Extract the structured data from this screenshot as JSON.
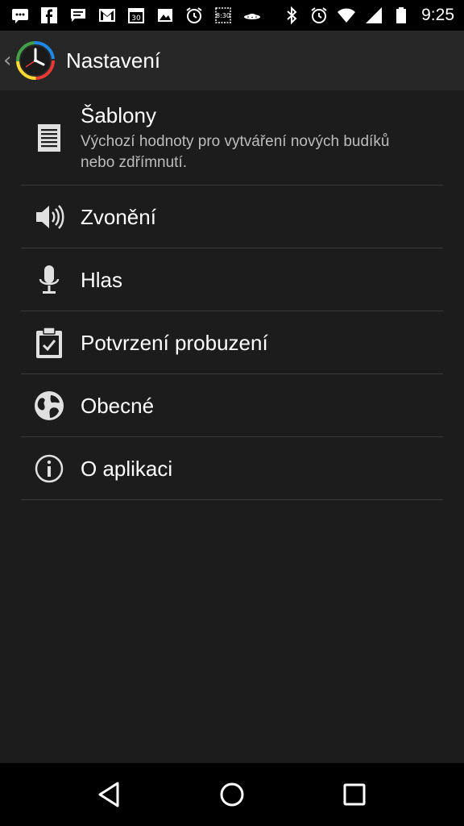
{
  "status_bar": {
    "time": "9:25",
    "left_icons": [
      "messages-icon",
      "facebook-icon",
      "chat-icon",
      "gmail-icon",
      "calendar-icon",
      "gallery-icon",
      "alarm-icon",
      "clock-icon",
      "ufo-icon"
    ],
    "right_icons": [
      "bluetooth-icon",
      "alarm-icon",
      "wifi-icon",
      "signal-icon",
      "battery-icon"
    ]
  },
  "app_bar": {
    "title": "Nastavení"
  },
  "settings": [
    {
      "name": "templates",
      "title": "Šablony",
      "summary": "Výchozí hodnoty pro vytváření nových budíků nebo zdřímnutí.",
      "icon": "document-icon"
    },
    {
      "name": "ringing",
      "title": "Zvonění",
      "summary": "",
      "icon": "speaker-icon"
    },
    {
      "name": "voice",
      "title": "Hlas",
      "summary": "",
      "icon": "microphone-icon"
    },
    {
      "name": "wake-confirm",
      "title": "Potvrzení probuzení",
      "summary": "",
      "icon": "clipboard-check-icon"
    },
    {
      "name": "general",
      "title": "Obecné",
      "summary": "",
      "icon": "globe-icon"
    },
    {
      "name": "about",
      "title": "O aplikaci",
      "summary": "",
      "icon": "info-icon"
    }
  ],
  "nav_bar": {
    "buttons": [
      "back-icon",
      "home-icon",
      "recents-icon"
    ]
  },
  "colors": {
    "background": "#1c1c1c",
    "app_bar": "#272727",
    "divider": "#3a3a3a",
    "summary_text": "#bdbdbd"
  }
}
